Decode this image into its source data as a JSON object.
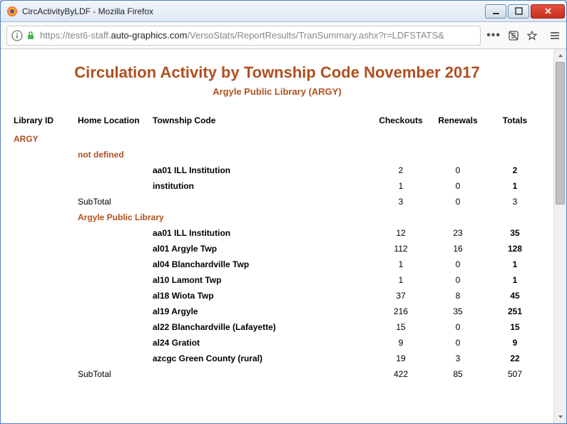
{
  "window": {
    "title": "CircActivityByLDF - Mozilla Firefox"
  },
  "url": {
    "prefix": "https://test6-staff.",
    "host": "auto-graphics.com",
    "rest": "/VersoStats/ReportResults/TranSummary.ashx?r=LDFSTATS&"
  },
  "report": {
    "title": "Circulation Activity by Township Code  November 2017",
    "subtitle": "Argyle Public Library (ARGY)"
  },
  "headers": {
    "library_id": "Library ID",
    "home_location": "Home Location",
    "township_code": "Township Code",
    "checkouts": "Checkouts",
    "renewals": "Renewals",
    "totals": "Totals"
  },
  "library_id": "ARGY",
  "subtotal_label": "SubTotal",
  "groups": [
    {
      "home_location": "not defined",
      "rows": [
        {
          "code": "aa01 ILL Institution",
          "checkouts": "2",
          "renewals": "0",
          "totals": "2"
        },
        {
          "code": "institution",
          "checkouts": "1",
          "renewals": "0",
          "totals": "1"
        }
      ],
      "subtotal": {
        "checkouts": "3",
        "renewals": "0",
        "totals": "3"
      }
    },
    {
      "home_location": "Argyle Public Library",
      "rows": [
        {
          "code": "aa01 ILL Institution",
          "checkouts": "12",
          "renewals": "23",
          "totals": "35"
        },
        {
          "code": "al01 Argyle Twp",
          "checkouts": "112",
          "renewals": "16",
          "totals": "128"
        },
        {
          "code": "al04 Blanchardville Twp",
          "checkouts": "1",
          "renewals": "0",
          "totals": "1"
        },
        {
          "code": "al10 Lamont Twp",
          "checkouts": "1",
          "renewals": "0",
          "totals": "1"
        },
        {
          "code": "al18 Wiota Twp",
          "checkouts": "37",
          "renewals": "8",
          "totals": "45"
        },
        {
          "code": "al19 Argyle",
          "checkouts": "216",
          "renewals": "35",
          "totals": "251"
        },
        {
          "code": "al22 Blanchardville (Lafayette)",
          "checkouts": "15",
          "renewals": "0",
          "totals": "15"
        },
        {
          "code": "al24 Gratiot",
          "checkouts": "9",
          "renewals": "0",
          "totals": "9"
        },
        {
          "code": "azcgc Green County (rural)",
          "checkouts": "19",
          "renewals": "3",
          "totals": "22"
        }
      ],
      "subtotal": {
        "checkouts": "422",
        "renewals": "85",
        "totals": "507"
      }
    }
  ]
}
